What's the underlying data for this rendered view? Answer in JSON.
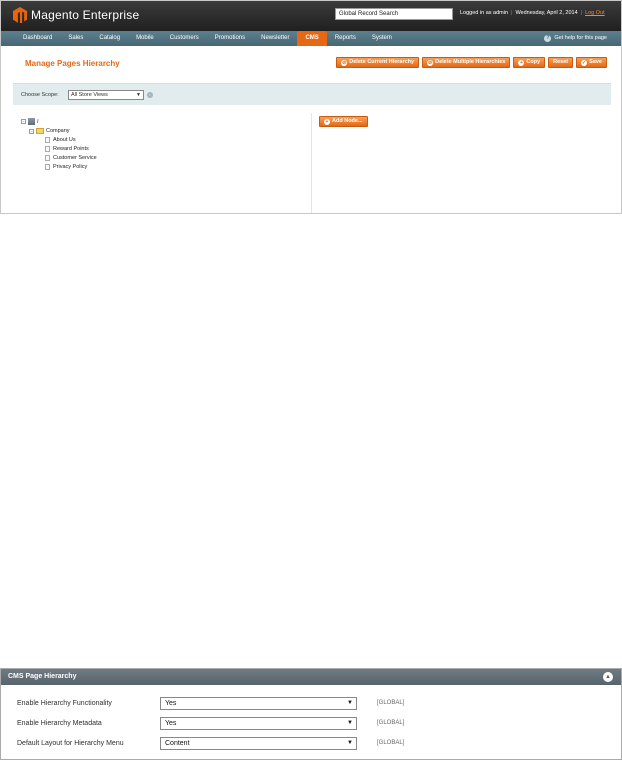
{
  "header": {
    "logo_brand": "Magento",
    "logo_product": "Enterprise",
    "global_search": "Global Record Search",
    "logged_in": "Logged in as admin",
    "date": "Wednesday, April 2, 2014",
    "logout": "Log Out"
  },
  "nav": {
    "items": [
      "Dashboard",
      "Sales",
      "Catalog",
      "Mobile",
      "Customers",
      "Promotions",
      "Newsletter",
      "CMS",
      "Reports",
      "System"
    ],
    "active": "CMS",
    "help": "Get help for this page"
  },
  "page": {
    "title": "Manage Pages Hierarchy",
    "buttons": {
      "delete_current": "Delete Current Hierarchy",
      "delete_multiple": "Delete Multiple Hierarchies",
      "copy": "Copy",
      "reset": "Reset",
      "save": "Save"
    }
  },
  "scope": {
    "label": "Choose Scope:",
    "value": "All Store Views"
  },
  "tree": {
    "root": "/",
    "folder": "Company",
    "pages": [
      "About Us",
      "Reward Points",
      "Customer Service",
      "Privacy Policy"
    ]
  },
  "add_node": "Add Node...",
  "config": {
    "title": "CMS Page Hierarchy",
    "rows": [
      {
        "label": "Enable Hierarchy Functionality",
        "value": "Yes",
        "scope": "[GLOBAL]"
      },
      {
        "label": "Enable Hierarchy Metadata",
        "value": "Yes",
        "scope": "[GLOBAL]"
      },
      {
        "label": "Default Layout for Hierarchy Menu",
        "value": "Content",
        "scope": "[GLOBAL]"
      }
    ]
  },
  "colors": {
    "accent": "#e76814",
    "nav": "#486775",
    "header": "#2b2b2b"
  }
}
